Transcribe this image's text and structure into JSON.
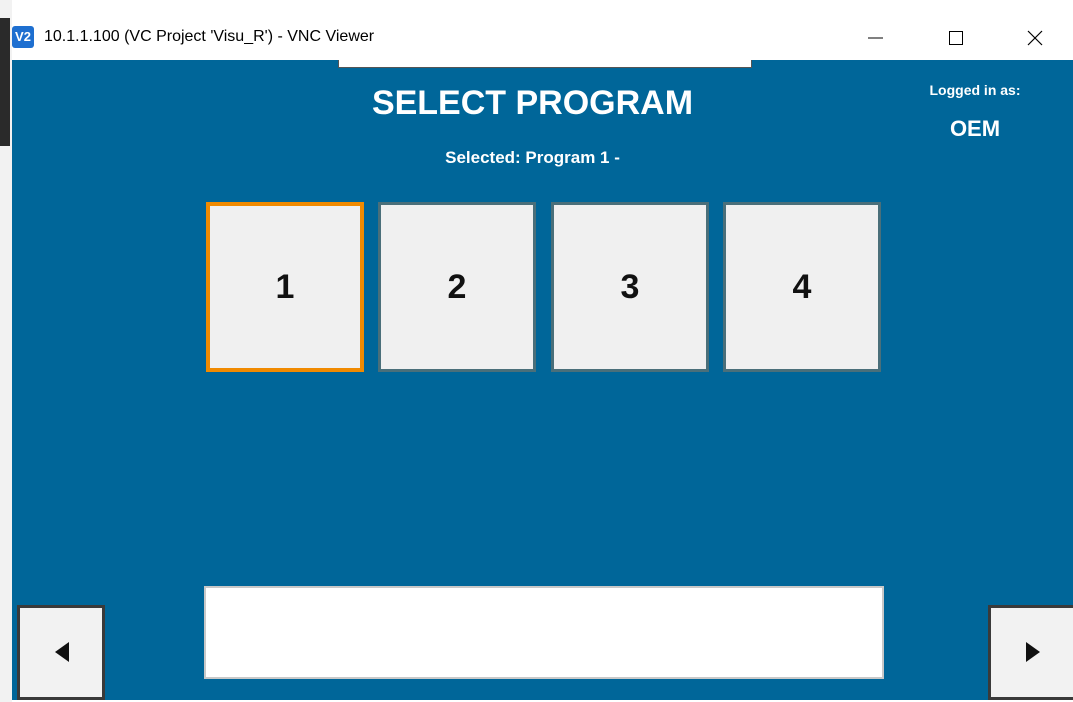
{
  "window": {
    "app_icon": "V2",
    "title": "10.1.1.100 (VC Project 'Visu_R') - VNC Viewer",
    "controls": [
      "minimize-icon",
      "maximize-icon",
      "close-icon"
    ]
  },
  "screen": {
    "title": "SELECT PROGRAM",
    "selected_text": "Selected: Program 1 -",
    "logged_in_label": "Logged in as:",
    "logged_in_user": "OEM"
  },
  "programs": [
    {
      "label": "1",
      "active": true
    },
    {
      "label": "2",
      "active": false
    },
    {
      "label": "3",
      "active": false
    },
    {
      "label": "4",
      "active": false
    }
  ],
  "message_box": {
    "value": ""
  },
  "nav": {
    "prev_icon": "triangle-left-icon",
    "next_icon": "triangle-right-icon"
  },
  "colors": {
    "background": "#006699",
    "active_border": "#f08a00",
    "button_face": "#f0f0f0"
  }
}
